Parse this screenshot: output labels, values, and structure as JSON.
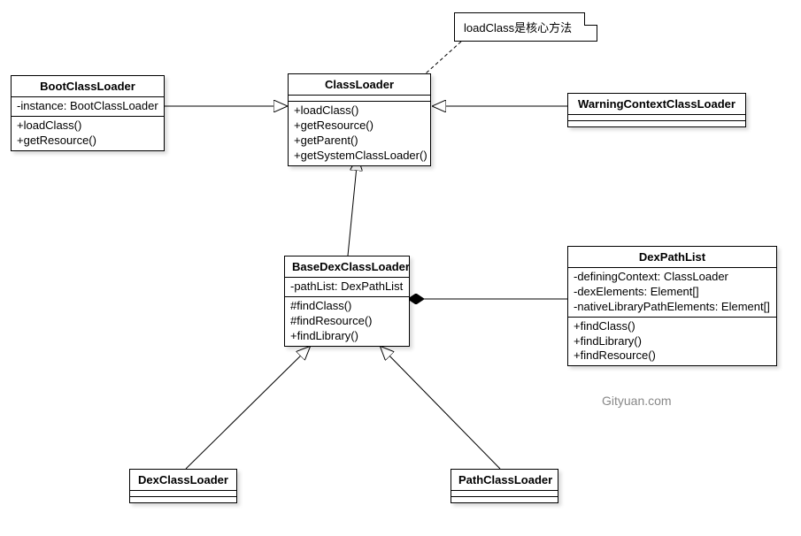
{
  "note": {
    "text": "loadClass是核心方法"
  },
  "classes": {
    "classLoader": {
      "name": "ClassLoader",
      "attrs": [],
      "methods": [
        "+loadClass()",
        "+getResource()",
        "+getParent()",
        "+getSystemClassLoader()"
      ]
    },
    "bootClassLoader": {
      "name": "BootClassLoader",
      "attrs": [
        "-instance: BootClassLoader"
      ],
      "methods": [
        "+loadClass()",
        "+getResource()"
      ]
    },
    "warningContextClassLoader": {
      "name": "WarningContextClassLoader",
      "attrs": [],
      "methods": []
    },
    "baseDexClassLoader": {
      "name": "BaseDexClassLoader",
      "attrs": [
        "-pathList: DexPathList"
      ],
      "methods": [
        "#findClass()",
        "#findResource()",
        "+findLibrary()"
      ]
    },
    "dexPathList": {
      "name": "DexPathList",
      "attrs": [
        "-definingContext: ClassLoader",
        "-dexElements: Element[]",
        "-nativeLibraryPathElements: Element[]"
      ],
      "methods": [
        "+findClass()",
        "+findLibrary()",
        "+findResource()"
      ]
    },
    "dexClassLoader": {
      "name": "DexClassLoader",
      "attrs": [],
      "methods": []
    },
    "pathClassLoader": {
      "name": "PathClassLoader",
      "attrs": [],
      "methods": []
    }
  },
  "watermark": "Gityuan.com"
}
